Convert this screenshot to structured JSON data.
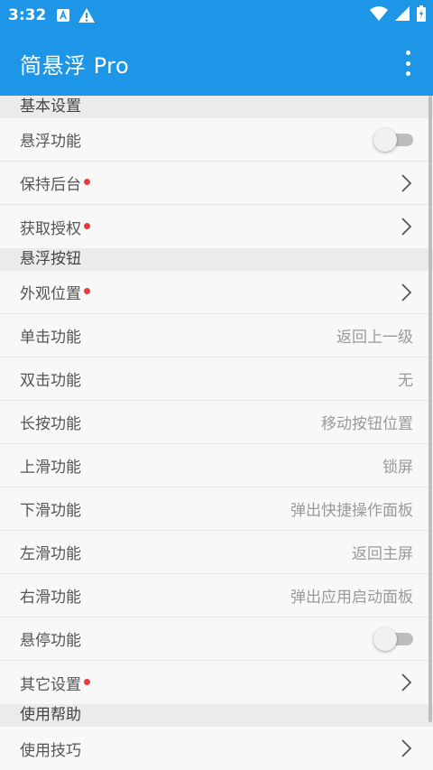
{
  "statusbar": {
    "time": "3:32"
  },
  "appbar": {
    "title": "简悬浮 Pro"
  },
  "colors": {
    "primary": "#1e96e8",
    "dot": "#ec3a3a"
  },
  "sections": {
    "basic": {
      "title": "基本设置"
    },
    "button": {
      "title": "悬浮按钮"
    },
    "help": {
      "title": "使用帮助"
    }
  },
  "rows": {
    "float": {
      "label": "悬浮功能",
      "toggle": false
    },
    "keep_bg": {
      "label": "保持后台"
    },
    "auth": {
      "label": "获取授权"
    },
    "appearance": {
      "label": "外观位置"
    },
    "single": {
      "label": "单击功能",
      "value": "返回上一级"
    },
    "double": {
      "label": "双击功能",
      "value": "无"
    },
    "long": {
      "label": "长按功能",
      "value": "移动按钮位置"
    },
    "up": {
      "label": "上滑功能",
      "value": "锁屏"
    },
    "down": {
      "label": "下滑功能",
      "value": "弹出快捷操作面板"
    },
    "left": {
      "label": "左滑功能",
      "value": "返回主屏"
    },
    "right": {
      "label": "右滑功能",
      "value": "弹出应用启动面板"
    },
    "hover": {
      "label": "悬停功能",
      "toggle": false
    },
    "other": {
      "label": "其它设置"
    },
    "tips": {
      "label": "使用技巧"
    }
  }
}
